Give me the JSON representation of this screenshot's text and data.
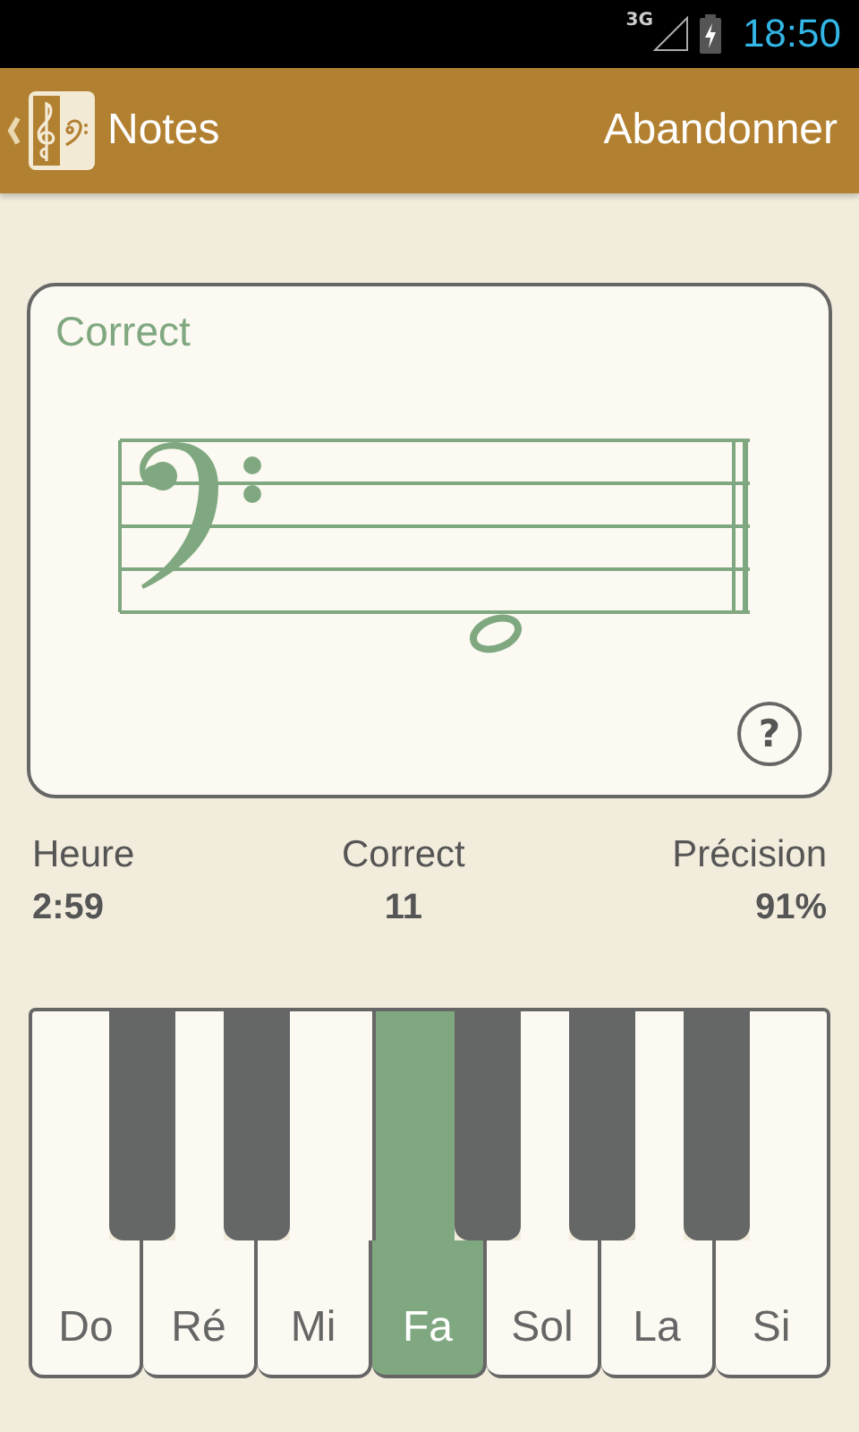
{
  "status_bar": {
    "network": "3G",
    "time": "18:50"
  },
  "app_bar": {
    "title": "Notes",
    "action": "Abandonner"
  },
  "card": {
    "result": "Correct",
    "help_button": "?"
  },
  "stats": [
    {
      "label": "Heure",
      "value": "2:59"
    },
    {
      "label": "Correct",
      "value": "11"
    },
    {
      "label": "Précision",
      "value": "91%"
    }
  ],
  "keys": [
    {
      "label": "Do",
      "selected": false
    },
    {
      "label": "Ré",
      "selected": false
    },
    {
      "label": "Mi",
      "selected": false
    },
    {
      "label": "Fa",
      "selected": true
    },
    {
      "label": "Sol",
      "selected": false
    },
    {
      "label": "La",
      "selected": false
    },
    {
      "label": "Si",
      "selected": false
    }
  ]
}
